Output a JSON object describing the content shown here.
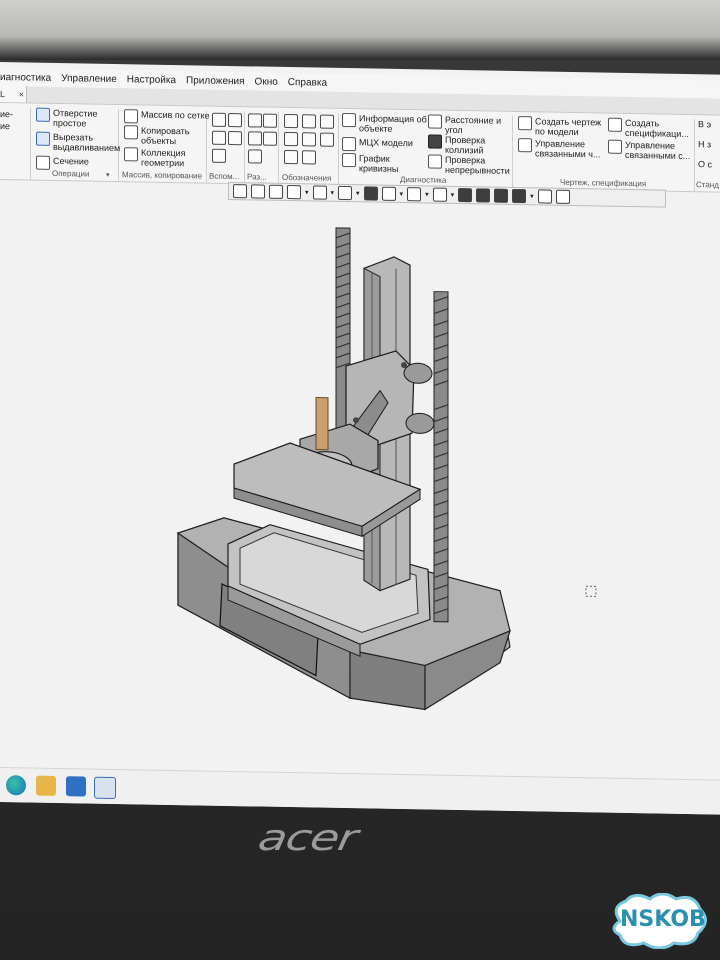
{
  "menubar": {
    "items": [
      "иагностика",
      "Управление",
      "Настройка",
      "Приложения",
      "Окно",
      "Справка"
    ]
  },
  "tab": {
    "label": "L",
    "close": "×"
  },
  "ribbon": {
    "left_stub": [
      "ие-",
      "ие"
    ],
    "operations": {
      "label": "Операции",
      "buttons": [
        "Отверстие простое",
        "Вырезать выдавливанием",
        "Сечение"
      ]
    },
    "arrays": {
      "label": "Массив, копирование",
      "buttons": [
        "Массив по сетке",
        "Копировать объекты",
        "Коллекция геометрии"
      ]
    },
    "aux": {
      "label": "Вспом..."
    },
    "sizes": {
      "label": "Раз..."
    },
    "annotations": {
      "label": "Обозначения"
    },
    "diagnostics": {
      "label": "Диагностика",
      "buttons": [
        "Информация об объекте",
        "МЦХ модели",
        "График кривизны",
        "Расстояние и угол",
        "Проверка коллизий",
        "Проверка непрерывности"
      ]
    },
    "drawing": {
      "label": "Чертеж, спецификация",
      "buttons": [
        "Создать чертеж по модели",
        "Управление связанными ч...",
        "Создать спецификаци...",
        "Управление связанными с..."
      ]
    },
    "standard": {
      "label": "Станд",
      "buttons": [
        "В э",
        "Н з",
        "О с"
      ]
    }
  },
  "taskbar": {
    "apps": [
      "edge-icon",
      "file-explorer-icon",
      "mail-icon",
      "kompas-3d-icon"
    ]
  },
  "bezel": {
    "brand": "acer"
  },
  "watermark": {
    "text": "NSKOB"
  },
  "colors": {
    "model_gray": "#9a9a9a",
    "model_dark": "#6e6e6e",
    "screen_bg": "#f2f2f2",
    "accent_blue": "#3b6db4",
    "brass_nut": "#c8a070"
  }
}
